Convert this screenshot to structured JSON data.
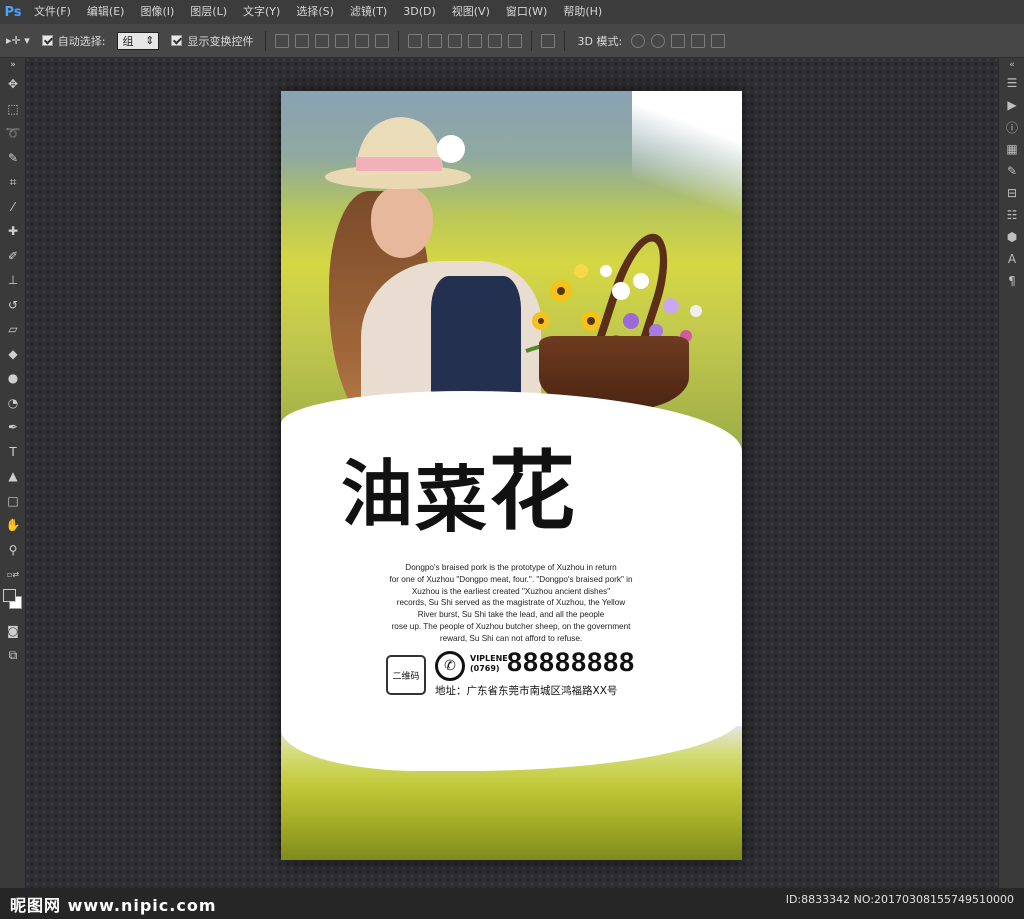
{
  "app": {
    "logo": "Ps"
  },
  "menu": [
    "文件(F)",
    "编辑(E)",
    "图像(I)",
    "图层(L)",
    "文字(Y)",
    "选择(S)",
    "滤镜(T)",
    "3D(D)",
    "视图(V)",
    "窗口(W)",
    "帮助(H)"
  ],
  "options": {
    "auto_select_label": "自动选择:",
    "auto_select_value": "组",
    "show_transform_label": "显示变换控件",
    "mode_label": "3D 模式:"
  },
  "poster": {
    "title_chars": [
      "油",
      "菜",
      "花"
    ],
    "body_lines": [
      "Dongpo's braised pork is the prototype of Xuzhou in return",
      "for one of Xuzhou \"Dongpo meat, four.\". \"Dongpo's braised pork\" in",
      "Xuzhou is the earliest created \"Xuzhou ancient dishes\"",
      "records, Su Shi served as the magistrate of Xuzhou, the Yellow",
      "River burst, Su Shi take the lead, and all the people",
      "rose up. The people of Xuzhou butcher sheep, on the government",
      "reward, Su Shi can not afford to refuse."
    ],
    "qr_label": "二维码",
    "vip_label": "VIPLENE",
    "area_code": "(0769)",
    "phone": "88888888",
    "address": "地址：广东省东莞市南城区鸿福路XX号"
  },
  "watermark": {
    "left": "昵图网 www.nipic.com",
    "right": "ID:8833342 NO:20170308155749510000"
  },
  "colors": {
    "menubar": "#3c3c3c",
    "optionsbar": "#474747",
    "canvas": "#2f2f33",
    "accent_logo": "#4aa3ff"
  }
}
